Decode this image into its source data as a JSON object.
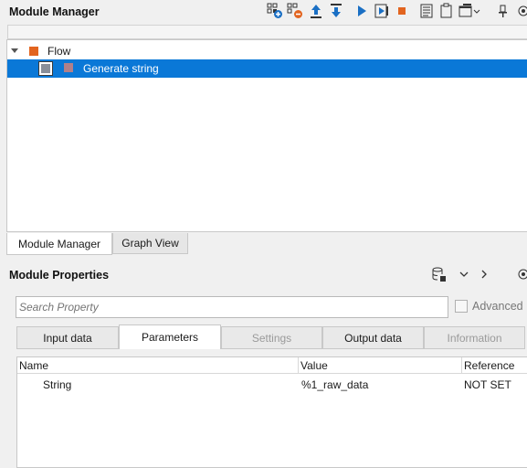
{
  "module_manager": {
    "title": "Module Manager",
    "tree": [
      {
        "label": "Flow",
        "color": "#e2641f"
      },
      {
        "label": "Generate string",
        "color": "#b0808a",
        "selected": true
      }
    ],
    "tabs": [
      "Module Manager",
      "Graph View"
    ],
    "toolbar_icons": [
      "add-module-icon",
      "remove-module-icon",
      "move-up-icon",
      "move-down-icon",
      "run-icon",
      "step-icon",
      "stop-icon",
      "log-icon",
      "clipboard-icon",
      "window-icon",
      "pin-icon",
      "close-panel-icon"
    ]
  },
  "module_properties": {
    "title": "Module Properties",
    "search_placeholder": "Search Property",
    "advanced_label": "Advanced",
    "tabs": [
      {
        "label": "Input data"
      },
      {
        "label": "Parameters",
        "selected": true
      },
      {
        "label": "Settings",
        "disabled": true
      },
      {
        "label": "Output data"
      },
      {
        "label": "Information",
        "disabled": true
      }
    ],
    "table": {
      "columns": [
        "Name",
        "Value",
        "Reference"
      ],
      "rows": [
        {
          "name": "String",
          "value": "%1_raw_data",
          "reference": "NOT SET"
        }
      ]
    }
  },
  "colors": {
    "selection": "#0a78d7",
    "stop": "#e2641f",
    "run": "#1a6fc4"
  }
}
